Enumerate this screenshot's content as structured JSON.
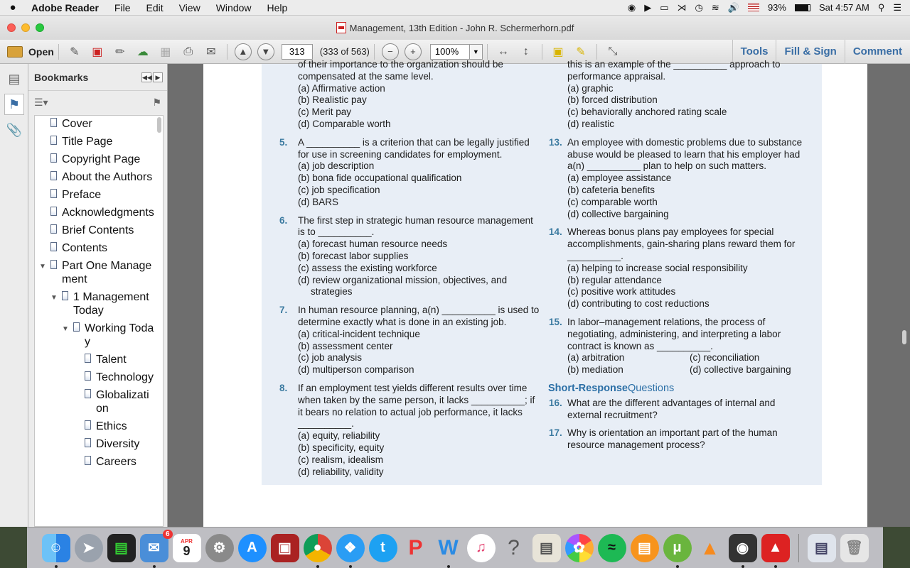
{
  "menubar": {
    "apple": "",
    "app_name": "Adobe Reader",
    "menus": [
      "File",
      "Edit",
      "View",
      "Window",
      "Help"
    ],
    "battery": "93%",
    "clock": "Sat 4:57 AM"
  },
  "window": {
    "title": "Management, 13th Edition - John R. Schermerhorn.pdf"
  },
  "toolbar": {
    "open_label": "Open",
    "page_number": "313",
    "page_count": "(333 of 563)",
    "zoom": "100%",
    "tools_label": "Tools",
    "fill_sign_label": "Fill & Sign",
    "comment_label": "Comment"
  },
  "bookmarks": {
    "title": "Bookmarks",
    "items": [
      {
        "label": "Cover",
        "level": 0,
        "toggle": ""
      },
      {
        "label": "Title Page",
        "level": 0,
        "toggle": ""
      },
      {
        "label": "Copyright Page",
        "level": 0,
        "toggle": ""
      },
      {
        "label": "About the Authors",
        "level": 0,
        "toggle": ""
      },
      {
        "label": "Preface",
        "level": 0,
        "toggle": ""
      },
      {
        "label": "Acknowledgments",
        "level": 0,
        "toggle": ""
      },
      {
        "label": "Brief Contents",
        "level": 0,
        "toggle": ""
      },
      {
        "label": "Contents",
        "level": 0,
        "toggle": ""
      },
      {
        "label": "Part One Management",
        "level": 0,
        "toggle": "▼"
      },
      {
        "label": "1 Management Today",
        "level": 1,
        "toggle": "▼"
      },
      {
        "label": "Working Today",
        "level": 2,
        "toggle": "▼"
      },
      {
        "label": "Talent",
        "level": 3,
        "toggle": ""
      },
      {
        "label": "Technology",
        "level": 3,
        "toggle": ""
      },
      {
        "label": "Globalization",
        "level": 3,
        "toggle": ""
      },
      {
        "label": "Ethics",
        "level": 3,
        "toggle": ""
      },
      {
        "label": "Diversity",
        "level": 3,
        "toggle": ""
      },
      {
        "label": "Careers",
        "level": 3,
        "toggle": ""
      }
    ]
  },
  "document": {
    "left_column": [
      {
        "num": "",
        "text": "of their importance to the organization should be compensated at the same level.",
        "options": [
          "(a) Affirmative action",
          "(b) Realistic pay",
          "(c) Merit pay",
          "(d) Comparable worth"
        ]
      },
      {
        "num": "5.",
        "text": "A __________ is a criterion that can be legally justified for use in screening candidates for employment.",
        "options": [
          "(a) job description",
          "(b) bona fide occupational qualification",
          "(c) job specification",
          "(d) BARS"
        ]
      },
      {
        "num": "6.",
        "text": "The first step in strategic human resource management is to __________.",
        "options": [
          "(a) forecast human resource needs",
          "(b) forecast labor supplies",
          "(c) assess the existing workforce",
          "(d) review organizational mission, objectives, and strategies"
        ]
      },
      {
        "num": "7.",
        "text": "In human resource planning, a(n) __________ is used to determine exactly what is done in an existing job.",
        "options": [
          "(a) critical-incident technique",
          "(b) assessment center",
          "(c) job analysis",
          "(d) multiperson comparison"
        ]
      },
      {
        "num": "8.",
        "text": "If an employment test yields different results over time when taken by the same person, it lacks __________; if it bears no relation to actual job performance, it lacks __________.",
        "options": [
          "(a) equity, reliability",
          "(b) specificity, equity",
          "(c) realism, idealism",
          "(d) reliability, validity"
        ]
      }
    ],
    "right_column": [
      {
        "num": "",
        "text": "this is an example of the __________ approach to performance appraisal.",
        "options": [
          "(a) graphic",
          "(b) forced distribution",
          "(c) behaviorally anchored rating scale",
          "(d) realistic"
        ]
      },
      {
        "num": "13.",
        "text": "An employee with domestic problems due to substance abuse would be pleased to learn that his employer had a(n) __________ plan to help on such matters.",
        "options": [
          "(a) employee assistance",
          "(b) cafeteria benefits",
          "(c) comparable worth",
          "(d) collective bargaining"
        ]
      },
      {
        "num": "14.",
        "text": "Whereas bonus plans pay employees for special accomplishments, gain-sharing plans reward them for __________.",
        "options": [
          "(a) helping to increase social responsibility",
          "(b) regular attendance",
          "(c) positive work attitudes",
          "(d) contributing to cost reductions"
        ]
      },
      {
        "num": "15.",
        "text": "In labor–management relations, the process of negotiating, administering, and interpreting a labor contract is known as __________.",
        "options": [
          "(a) arbitration",
          "(c) reconciliation",
          "(b) mediation",
          "(d) collective bargaining"
        ]
      }
    ],
    "short_response": {
      "heading_bold": "Short-Response",
      "heading_rest": "Questions",
      "questions": [
        {
          "num": "16.",
          "text": "What are the different advantages of internal and external recruitment?"
        },
        {
          "num": "17.",
          "text": "Why is orientation an important part of the human resource management process?"
        }
      ]
    }
  },
  "dock": {
    "badges": {
      "mail": "6",
      "calendar_month": "APR",
      "calendar_day": "9"
    }
  },
  "colors": {
    "question_box": "#e8eef6",
    "question_number": "#3b7aa0",
    "link_blue": "#3a6ea5"
  }
}
